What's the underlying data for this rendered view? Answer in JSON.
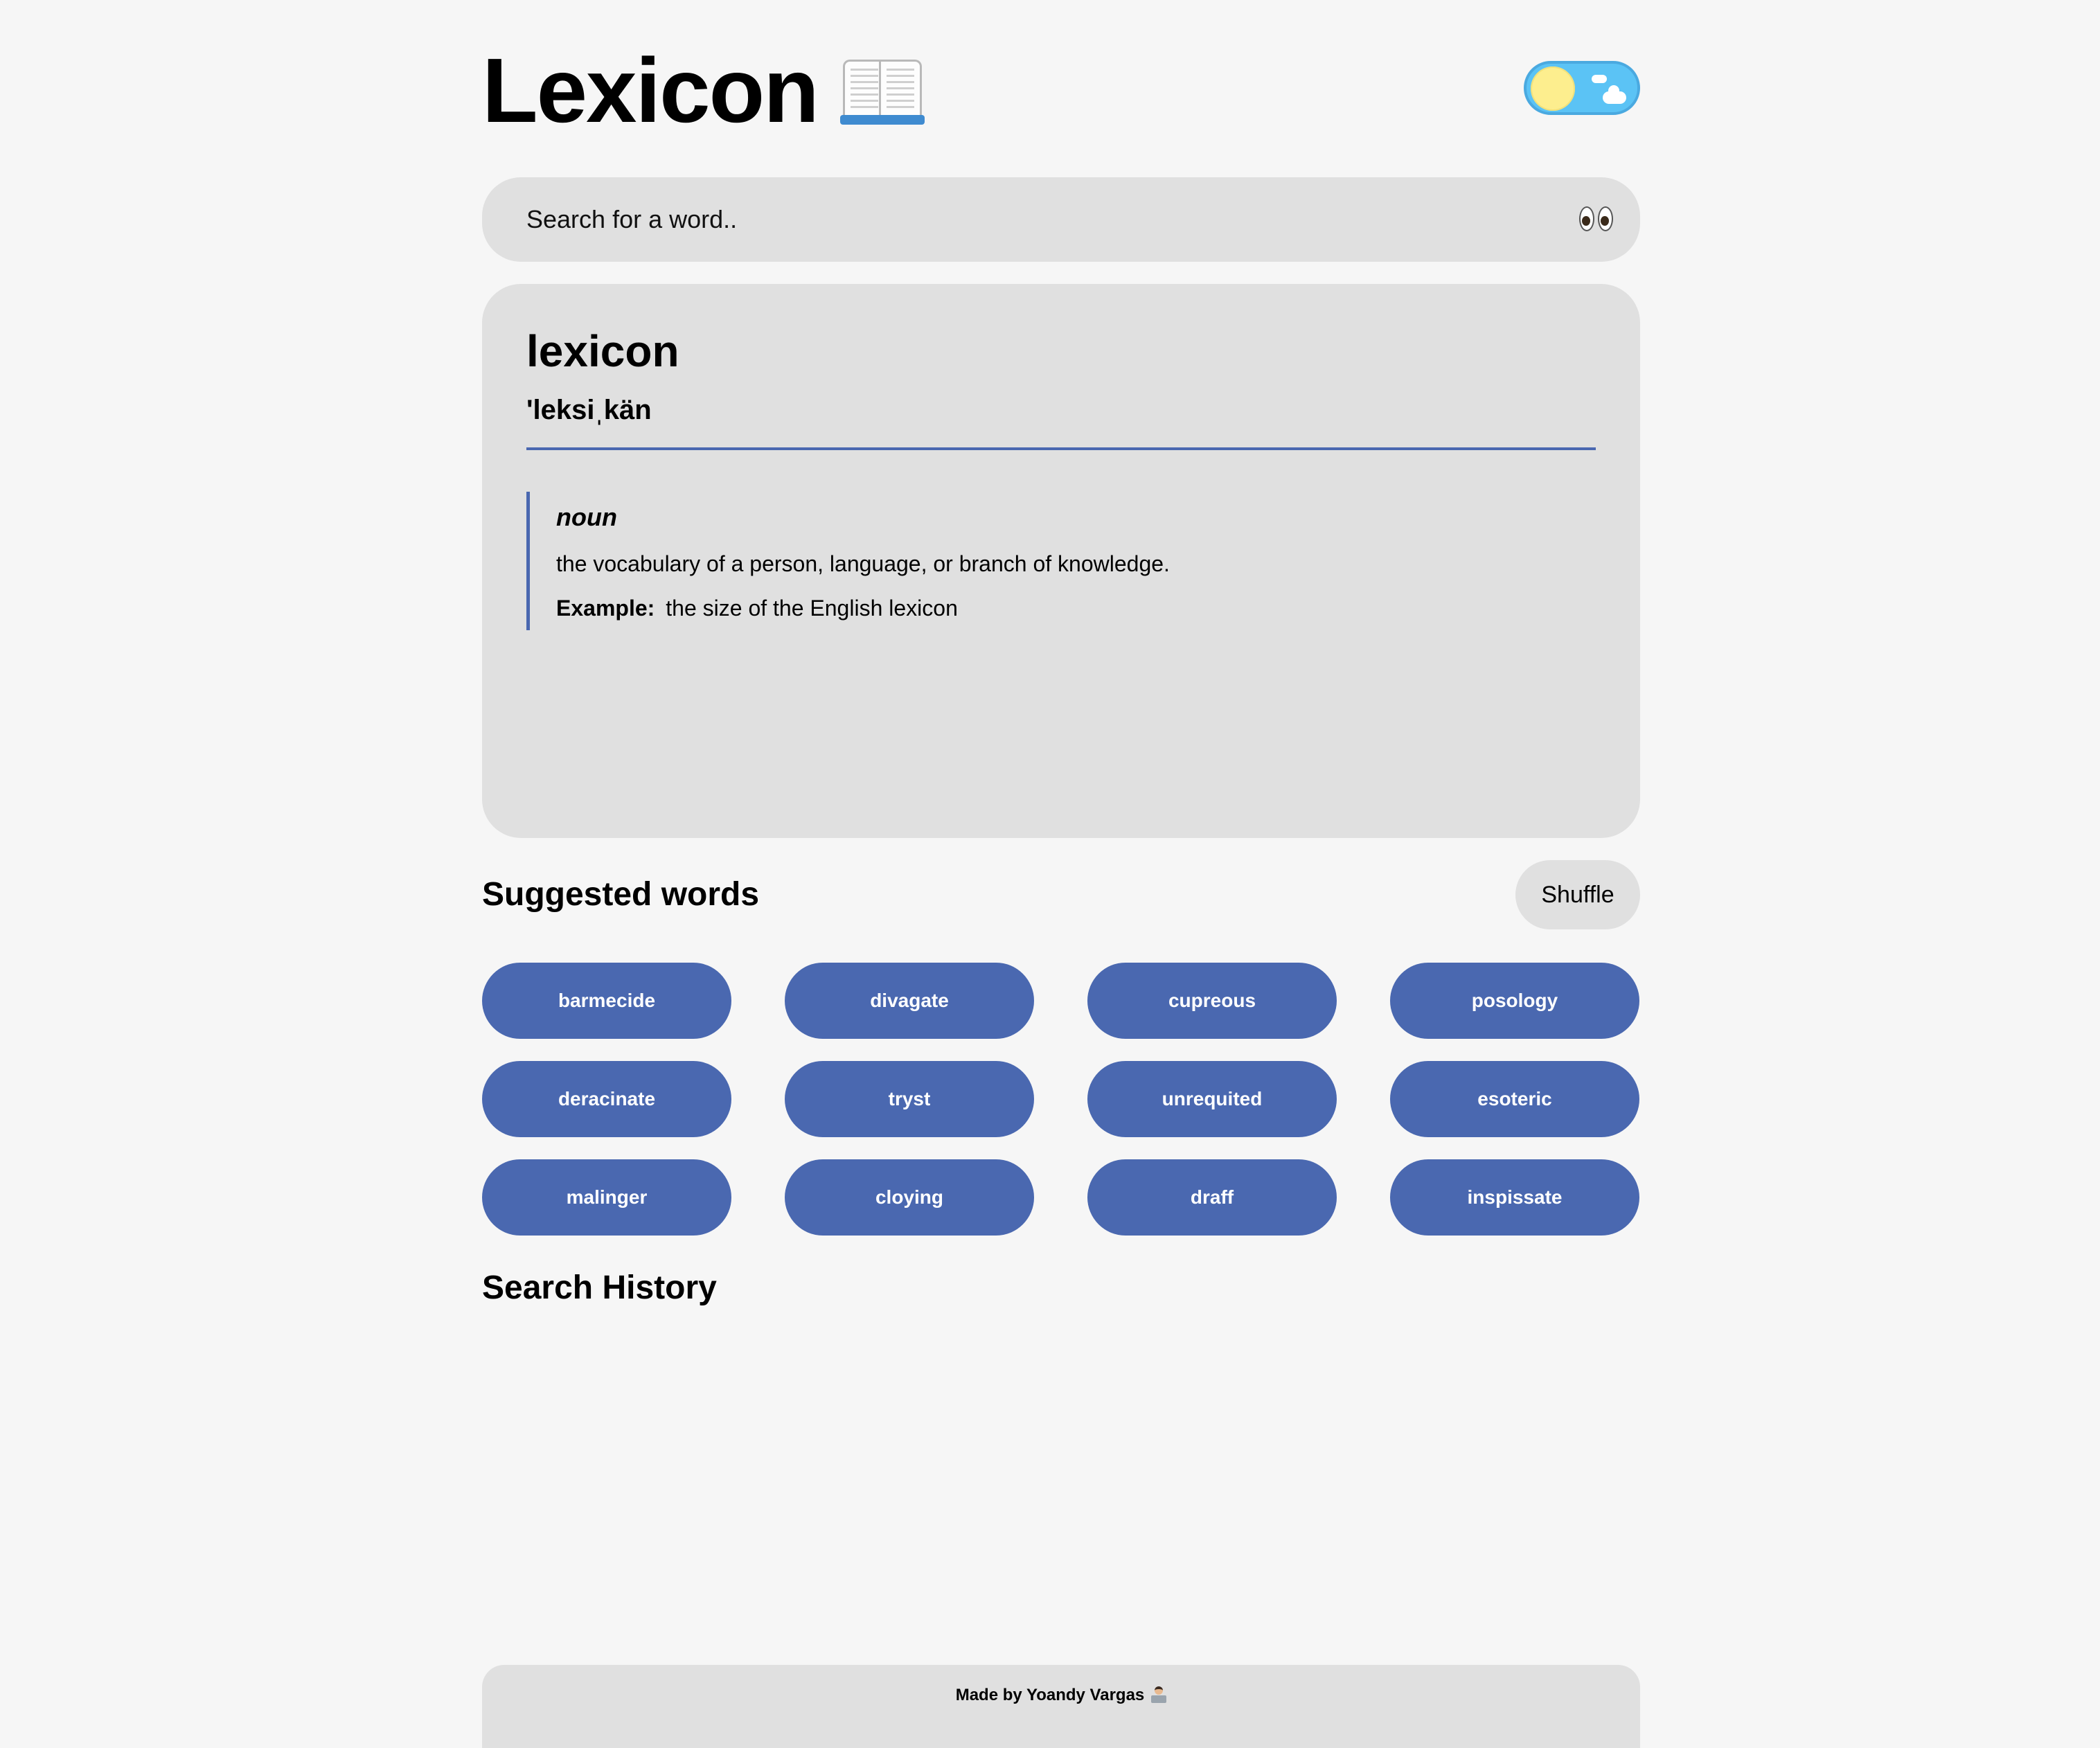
{
  "header": {
    "app_title": "Lexicon",
    "title_icon": "open-book-icon",
    "theme_toggle_state": "light"
  },
  "search": {
    "placeholder": "Search for a word..",
    "value": "",
    "icon": "eyes-icon"
  },
  "entry": {
    "word": "lexicon",
    "phonetic": "'leksiˌkän",
    "meanings": [
      {
        "part_of_speech": "noun",
        "definition": "the vocabulary of a person, language, or branch of knowledge.",
        "example_label": "Example:",
        "example": "the size of the English lexicon"
      }
    ]
  },
  "suggested": {
    "title": "Suggested words",
    "shuffle_label": "Shuffle",
    "words": [
      "barmecide",
      "divagate",
      "cupreous",
      "posology",
      "deracinate",
      "tryst",
      "unrequited",
      "esoteric",
      "malinger",
      "cloying",
      "draff",
      "inspissate"
    ]
  },
  "history": {
    "title": "Search History",
    "items": []
  },
  "footer": {
    "text": "Made by Yoandy Vargas",
    "icon": "technologist-icon"
  },
  "colors": {
    "background": "#f6f6f6",
    "card": "#e0e0e0",
    "accent": "#4a68b0",
    "toggle_sky": "#5bc3f5",
    "toggle_sun": "#fdee8e"
  }
}
